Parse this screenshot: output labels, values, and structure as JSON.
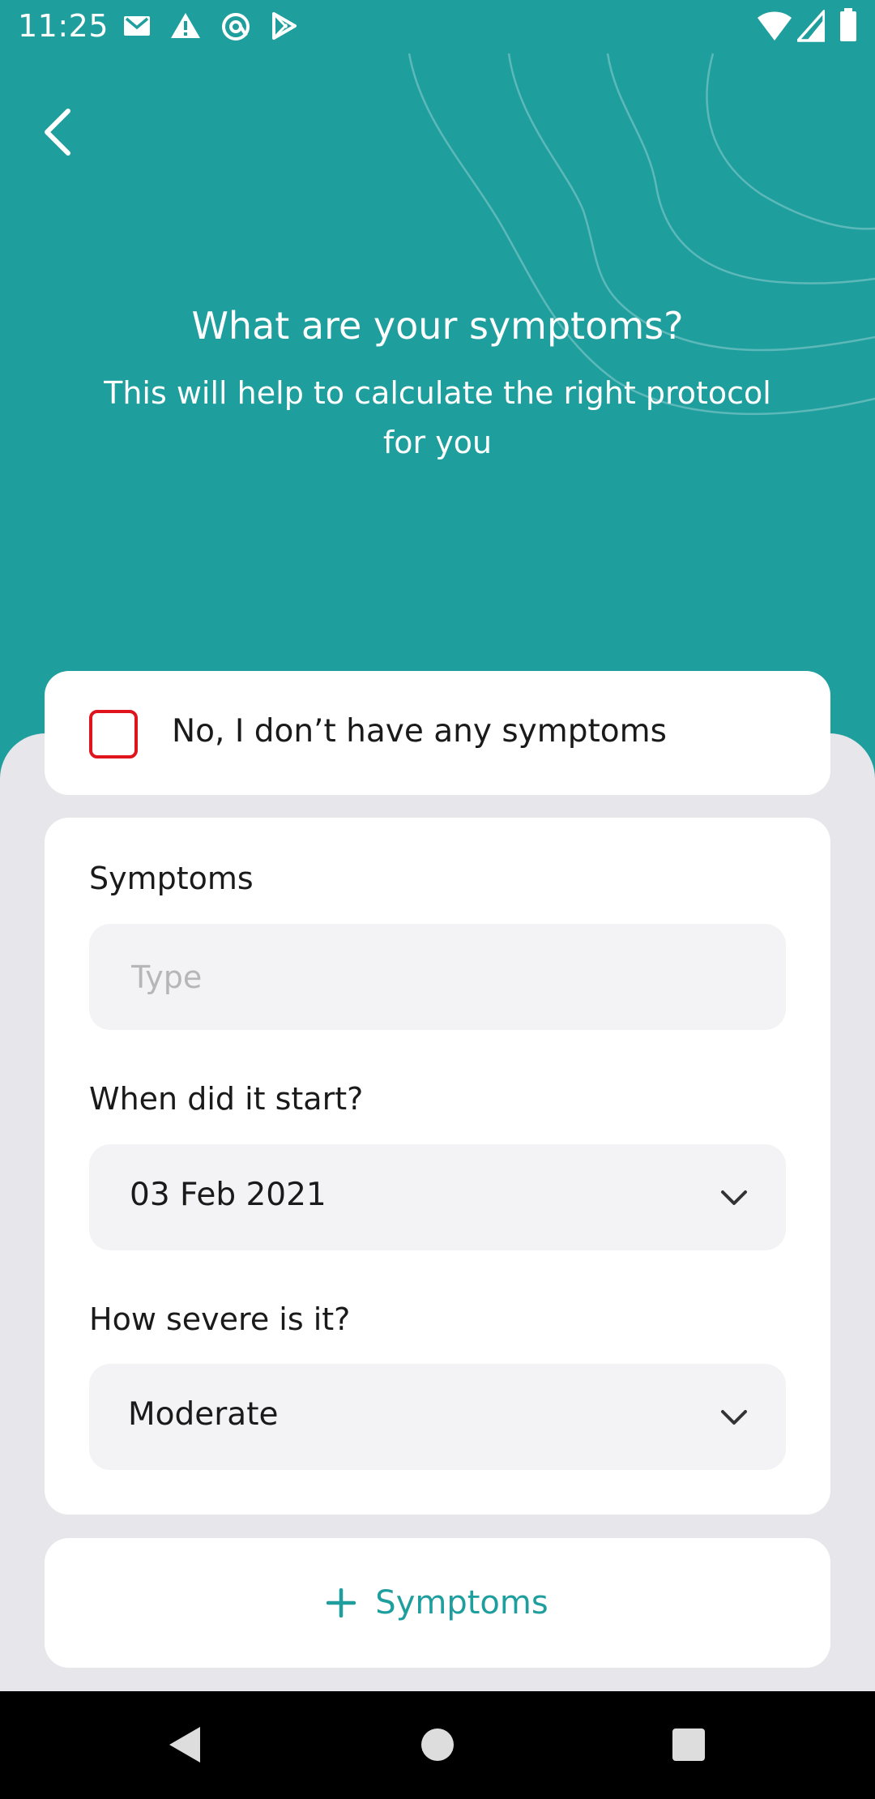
{
  "status_bar": {
    "time": "11:25",
    "left_icons": [
      "mail-icon",
      "warning-icon",
      "at-sign-icon",
      "play-store-icon"
    ],
    "right_icons": [
      "wifi-icon",
      "signal-icon",
      "battery-icon"
    ]
  },
  "header": {
    "title": "What are your symptoms?",
    "subtitle": "This will help to calculate the right protocol for you",
    "back_icon": "chevron-left-icon"
  },
  "no_symptoms": {
    "label": "No, I don’t have any symptoms",
    "checked": false,
    "checkbox_color": "#E0141C"
  },
  "form": {
    "symptoms_label": "Symptoms",
    "symptoms_placeholder": "Type",
    "symptoms_value": "",
    "start_label": "When did it start?",
    "start_value": "03 Feb 2021",
    "severity_label": "How severe is it?",
    "severity_value": "Moderate"
  },
  "add_button": {
    "label": "Symptoms",
    "icon": "plus-icon"
  },
  "nav": [
    "back-triangle-icon",
    "home-circle-icon",
    "recents-square-icon"
  ],
  "colors": {
    "accent": "#1F9E9E",
    "sheet_background": "#E7E7EB",
    "field_background": "#F3F3F5"
  }
}
